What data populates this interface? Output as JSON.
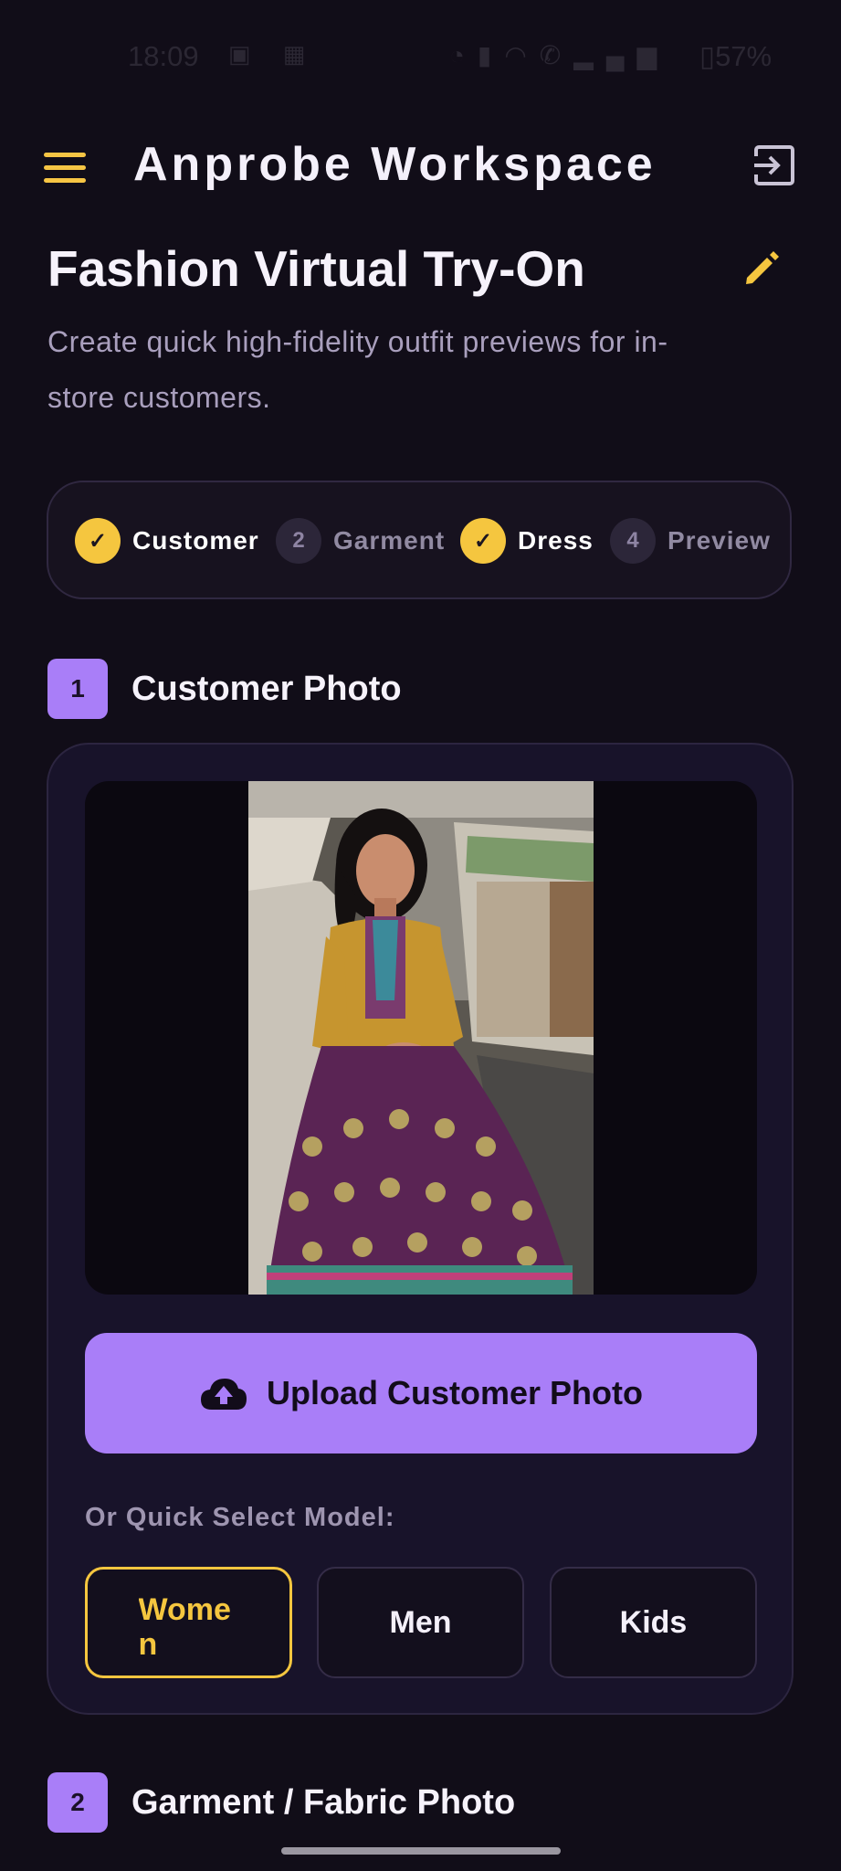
{
  "status_bar": {
    "time": "18:09",
    "battery": "57%",
    "left_icons": [
      "notification-icon",
      "linkedin-icon"
    ],
    "right_icons": [
      "alarm-icon",
      "vibrate-icon",
      "wifi-icon",
      "wifi-call-icon",
      "signal-icon",
      "battery-icon"
    ]
  },
  "app_bar": {
    "title": "Anprobe Workspace",
    "menu_icon": "menu-icon",
    "action_icon": "logout-icon"
  },
  "header": {
    "title": "Fashion Virtual Try-On",
    "subtitle": "Create quick high-fidelity outfit previews for in-store customers.",
    "edit_icon": "pencil-icon"
  },
  "steps": [
    {
      "label": "Customer",
      "number": "1",
      "done": true
    },
    {
      "label": "Garment",
      "number": "2",
      "done": false
    },
    {
      "label": "Dress",
      "number": "3",
      "done": true
    },
    {
      "label": "Preview",
      "number": "4",
      "done": false
    }
  ],
  "section1": {
    "number": "1",
    "title": "Customer Photo",
    "upload_label": "Upload Customer Photo",
    "quick_select_label": "Or Quick Select Model:",
    "models": [
      {
        "label": "Women",
        "selected": true
      },
      {
        "label": "Men",
        "selected": false
      },
      {
        "label": "Kids",
        "selected": false
      }
    ]
  },
  "section2": {
    "number": "2",
    "title": "Garment / Fabric Photo"
  },
  "colors": {
    "background": "#110d18",
    "accent_purple": "#a97ef8",
    "accent_yellow": "#f5c63f",
    "card": "#18132a"
  }
}
